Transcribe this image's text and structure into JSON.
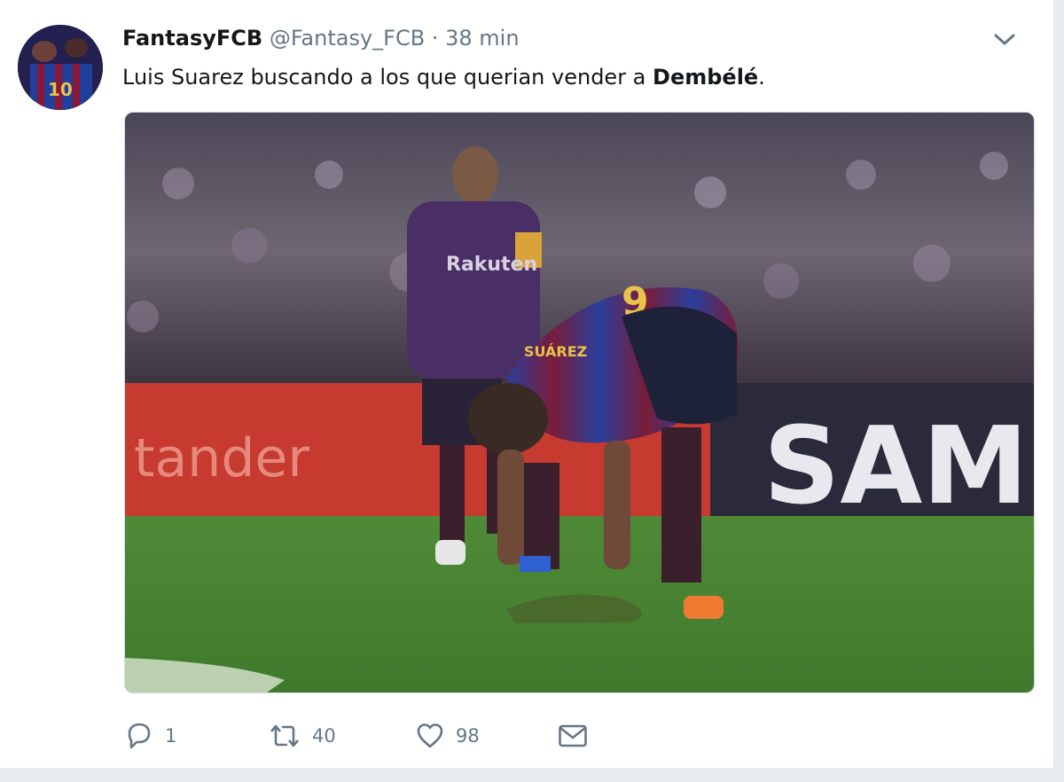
{
  "tweet": {
    "display_name": "FantasyFCB",
    "handle": "@Fantasy_FCB",
    "separator": "·",
    "time": "38 min",
    "text_plain": "Luis Suarez buscando a los que querian vender a ",
    "text_bold": "Dembélé",
    "text_end": ".",
    "media": {
      "ad_board_left": "tander",
      "ad_board_right": "SAMS",
      "jersey_name": "SUÁREZ",
      "jersey_number": "9",
      "shirt_sponsor": "Rakuten"
    }
  },
  "actions": {
    "reply_count": "1",
    "retweet_count": "40",
    "like_count": "98"
  },
  "icons": {
    "reply": "reply-icon",
    "retweet": "retweet-icon",
    "like": "heart-icon",
    "message": "envelope-icon",
    "menu": "chevron-down-icon"
  },
  "colors": {
    "name": "#14171a",
    "meta": "#657786",
    "icon": "#657786",
    "background": "#e6ecf0"
  }
}
